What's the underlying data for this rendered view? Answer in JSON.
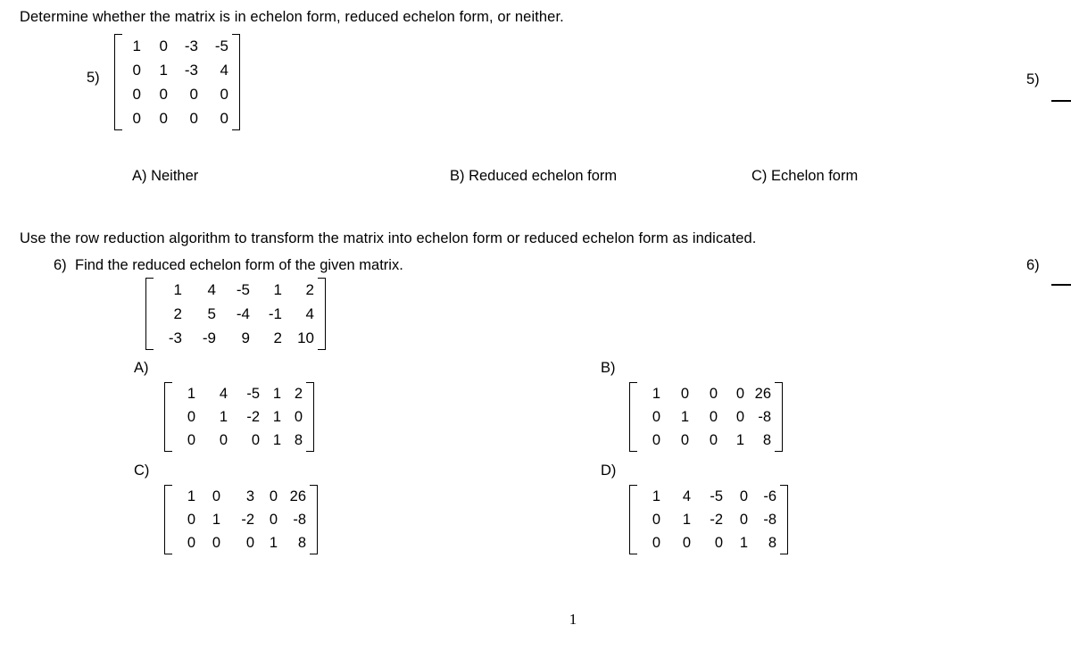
{
  "document": {
    "page_number": "1"
  },
  "sections": [
    {
      "instruction": "Determine whether the matrix is in echelon form, reduced echelon form, or neither.",
      "questions": [
        {
          "number": "5)",
          "right_number": "5)",
          "matrix": [
            [
              "1",
              "0",
              "-3",
              "-5"
            ],
            [
              "0",
              "1",
              "-3",
              "4"
            ],
            [
              "0",
              "0",
              "0",
              "0"
            ],
            [
              "0",
              "0",
              "0",
              "0"
            ]
          ],
          "options": [
            {
              "label": "A)",
              "text": "Neither"
            },
            {
              "label": "B)",
              "text": "Reduced echelon form"
            },
            {
              "label": "C)",
              "text": "Echelon form"
            }
          ]
        }
      ]
    },
    {
      "instruction": "Use the row reduction algorithm to transform the matrix into echelon form or reduced echelon form as indicated.",
      "questions": [
        {
          "number": "6)",
          "right_number": "6)",
          "text": "Find the reduced echelon form of the given matrix.",
          "matrix": [
            [
              "1",
              "4",
              "-5",
              "1",
              "2"
            ],
            [
              "2",
              "5",
              "-4",
              "-1",
              "4"
            ],
            [
              "-3",
              "-9",
              "9",
              "2",
              "10"
            ]
          ],
          "options": [
            {
              "label": "A)",
              "matrix": [
                [
                  "1",
                  "4",
                  "-5",
                  "1",
                  "2"
                ],
                [
                  "0",
                  "1",
                  "-2",
                  "1",
                  "0"
                ],
                [
                  "0",
                  "0",
                  "0",
                  "1",
                  "8"
                ]
              ]
            },
            {
              "label": "B)",
              "matrix": [
                [
                  "1",
                  "0",
                  "0",
                  "0",
                  "26"
                ],
                [
                  "0",
                  "1",
                  "0",
                  "0",
                  "-8"
                ],
                [
                  "0",
                  "0",
                  "0",
                  "1",
                  "8"
                ]
              ]
            },
            {
              "label": "C)",
              "matrix": [
                [
                  "1",
                  "0",
                  "3",
                  "0",
                  "26"
                ],
                [
                  "0",
                  "1",
                  "-2",
                  "0",
                  "-8"
                ],
                [
                  "0",
                  "0",
                  "0",
                  "1",
                  "8"
                ]
              ]
            },
            {
              "label": "D)",
              "matrix": [
                [
                  "1",
                  "4",
                  "-5",
                  "0",
                  "-6"
                ],
                [
                  "0",
                  "1",
                  "-2",
                  "0",
                  "-8"
                ],
                [
                  "0",
                  "0",
                  "0",
                  "1",
                  "8"
                ]
              ]
            }
          ]
        }
      ]
    }
  ]
}
